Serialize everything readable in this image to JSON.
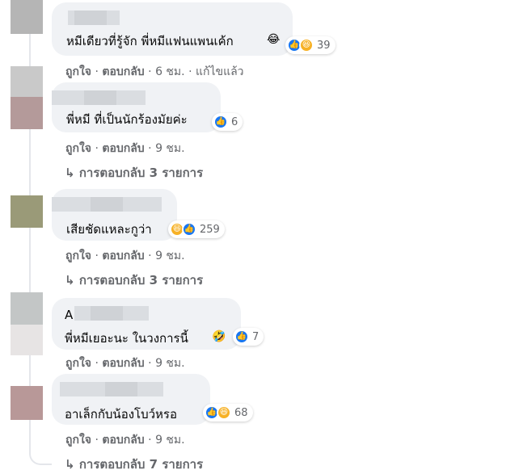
{
  "comments": [
    {
      "text": "หมีเดียวที่รู้จัก พี่หมีแฟนแพนเค้ก",
      "text_emoji": "😂",
      "reactions": {
        "icons": [
          "like-icon",
          "haha-icon"
        ],
        "count": "39"
      },
      "actions": {
        "like": "ถูกใจ",
        "reply": "ตอบกลับ",
        "time": "6 ชม.",
        "edited": "แก้ไขแล้ว"
      }
    },
    {
      "text": "พี่หมี ที่เป็นนักร้องมัยค่ะ",
      "reactions": {
        "icons": [
          "like-icon"
        ],
        "count": "6"
      },
      "actions": {
        "like": "ถูกใจ",
        "reply": "ตอบกลับ",
        "time": "9 ชม."
      },
      "replies": "การตอบกลับ 3 รายการ"
    },
    {
      "text": "เสียชัดแหละกูว่า",
      "reactions": {
        "icons": [
          "haha-icon",
          "like-icon"
        ],
        "count": "259"
      },
      "actions": {
        "like": "ถูกใจ",
        "reply": "ตอบกลับ",
        "time": "9 ชม."
      },
      "replies": "การตอบกลับ 3 รายการ"
    },
    {
      "name_initial": "A",
      "text": "พี่หมีเยอะนะ ในวงการนี้",
      "text_emoji": "🤣",
      "reactions": {
        "icons": [
          "like-icon"
        ],
        "count": "7"
      },
      "actions": {
        "like": "ถูกใจ",
        "reply": "ตอบกลับ",
        "time": "9 ชม."
      }
    },
    {
      "text": "อาเล็กกับน้องโบว์หรอ",
      "reactions": {
        "icons": [
          "like-icon",
          "haha-icon"
        ],
        "count": "68"
      },
      "actions": {
        "like": "ถูกใจ",
        "reply": "ตอบกลับ",
        "time": "9 ชม."
      },
      "replies": "การตอบกลับ 7 รายการ"
    }
  ],
  "separator": "·",
  "reply_arrow": "↳",
  "colors": {
    "bubble": "#f0f2f5",
    "like_blue": "#1877f2",
    "haha_yellow": "#f7b125",
    "meta_gray": "#65676b",
    "text": "#050505"
  }
}
